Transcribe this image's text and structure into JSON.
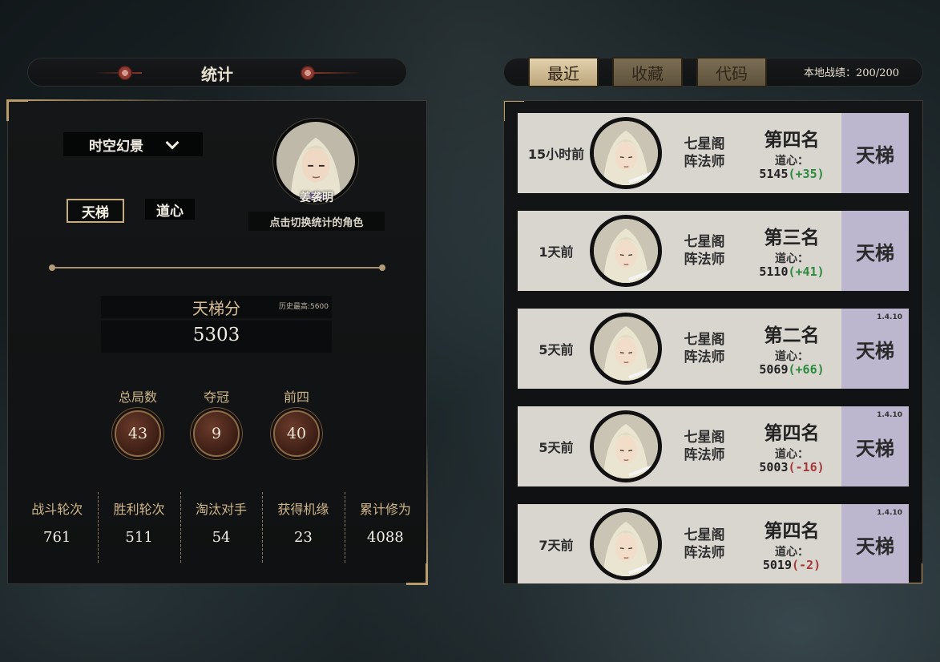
{
  "stats_header": {
    "title": "统计"
  },
  "left": {
    "mode_select": {
      "value": "时空幻景"
    },
    "tabs": [
      {
        "label": "天梯",
        "active": true
      },
      {
        "label": "道心",
        "active": false
      }
    ],
    "character": {
      "name": "姜袭明",
      "switch_hint": "点击切换统计的角色"
    },
    "score": {
      "label": "天梯分",
      "historical_best": "历史最高:5600",
      "value": "5303"
    },
    "badges": [
      {
        "label": "总局数",
        "value": "43"
      },
      {
        "label": "夺冠",
        "value": "9"
      },
      {
        "label": "前四",
        "value": "40"
      }
    ],
    "summary": [
      {
        "label": "战斗轮次",
        "value": "761"
      },
      {
        "label": "胜利轮次",
        "value": "511"
      },
      {
        "label": "淘汰对手",
        "value": "54"
      },
      {
        "label": "获得机缘",
        "value": "23"
      },
      {
        "label": "累计修为",
        "value": "4088"
      }
    ]
  },
  "right": {
    "tabs": [
      {
        "label": "最近",
        "active": true
      },
      {
        "label": "收藏",
        "active": false
      },
      {
        "label": "代码",
        "active": false
      }
    ],
    "local_record": "本地战绩：200/200",
    "matches": [
      {
        "time": "15小时前",
        "sect": "七星阁",
        "role": "阵法师",
        "rank": "第四名",
        "daoxin_label": "道心：",
        "daoxin": "5145",
        "delta": "(+35)",
        "delta_sign": "pos",
        "mode": "天梯",
        "version": ""
      },
      {
        "time": "1天前",
        "sect": "七星阁",
        "role": "阵法师",
        "rank": "第三名",
        "daoxin_label": "道心：",
        "daoxin": "5110",
        "delta": "(+41)",
        "delta_sign": "pos",
        "mode": "天梯",
        "version": ""
      },
      {
        "time": "5天前",
        "sect": "七星阁",
        "role": "阵法师",
        "rank": "第二名",
        "daoxin_label": "道心：",
        "daoxin": "5069",
        "delta": "(+66)",
        "delta_sign": "pos",
        "mode": "天梯",
        "version": "1.4.10"
      },
      {
        "time": "5天前",
        "sect": "七星阁",
        "role": "阵法师",
        "rank": "第四名",
        "daoxin_label": "道心：",
        "daoxin": "5003",
        "delta": "(-16)",
        "delta_sign": "neg",
        "mode": "天梯",
        "version": "1.4.10"
      },
      {
        "time": "7天前",
        "sect": "七星阁",
        "role": "阵法师",
        "rank": "第四名",
        "daoxin_label": "道心：",
        "daoxin": "5019",
        "delta": "(-2)",
        "delta_sign": "neg",
        "mode": "天梯",
        "version": "1.4.10"
      }
    ]
  },
  "colors": {
    "gold": "#b99b6c",
    "positive": "#2c8a3e",
    "negative": "#a83838",
    "mode_bg": "#bcb7cf",
    "card_bg": "#d9d6d0"
  }
}
